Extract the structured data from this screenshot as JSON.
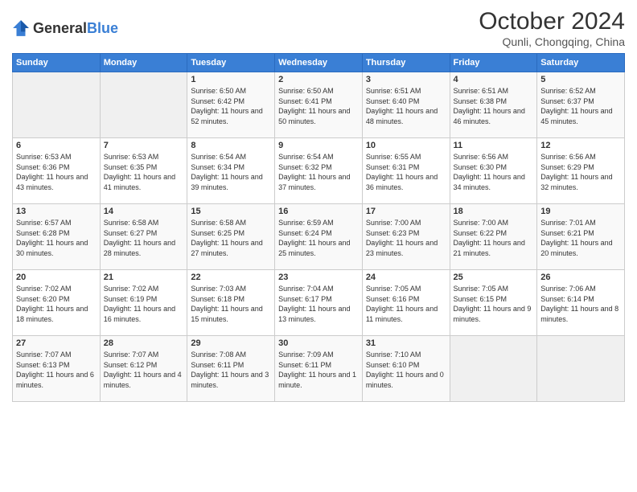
{
  "header": {
    "logo_general": "General",
    "logo_blue": "Blue",
    "title": "October 2024",
    "subtitle": "Qunli, Chongqing, China"
  },
  "weekdays": [
    "Sunday",
    "Monday",
    "Tuesday",
    "Wednesday",
    "Thursday",
    "Friday",
    "Saturday"
  ],
  "weeks": [
    [
      {
        "day": "",
        "empty": true
      },
      {
        "day": "",
        "empty": true
      },
      {
        "day": "1",
        "sunrise": "6:50 AM",
        "sunset": "6:42 PM",
        "daylight": "11 hours and 52 minutes."
      },
      {
        "day": "2",
        "sunrise": "6:50 AM",
        "sunset": "6:41 PM",
        "daylight": "11 hours and 50 minutes."
      },
      {
        "day": "3",
        "sunrise": "6:51 AM",
        "sunset": "6:40 PM",
        "daylight": "11 hours and 48 minutes."
      },
      {
        "day": "4",
        "sunrise": "6:51 AM",
        "sunset": "6:38 PM",
        "daylight": "11 hours and 46 minutes."
      },
      {
        "day": "5",
        "sunrise": "6:52 AM",
        "sunset": "6:37 PM",
        "daylight": "11 hours and 45 minutes."
      }
    ],
    [
      {
        "day": "6",
        "sunrise": "6:53 AM",
        "sunset": "6:36 PM",
        "daylight": "11 hours and 43 minutes."
      },
      {
        "day": "7",
        "sunrise": "6:53 AM",
        "sunset": "6:35 PM",
        "daylight": "11 hours and 41 minutes."
      },
      {
        "day": "8",
        "sunrise": "6:54 AM",
        "sunset": "6:34 PM",
        "daylight": "11 hours and 39 minutes."
      },
      {
        "day": "9",
        "sunrise": "6:54 AM",
        "sunset": "6:32 PM",
        "daylight": "11 hours and 37 minutes."
      },
      {
        "day": "10",
        "sunrise": "6:55 AM",
        "sunset": "6:31 PM",
        "daylight": "11 hours and 36 minutes."
      },
      {
        "day": "11",
        "sunrise": "6:56 AM",
        "sunset": "6:30 PM",
        "daylight": "11 hours and 34 minutes."
      },
      {
        "day": "12",
        "sunrise": "6:56 AM",
        "sunset": "6:29 PM",
        "daylight": "11 hours and 32 minutes."
      }
    ],
    [
      {
        "day": "13",
        "sunrise": "6:57 AM",
        "sunset": "6:28 PM",
        "daylight": "11 hours and 30 minutes."
      },
      {
        "day": "14",
        "sunrise": "6:58 AM",
        "sunset": "6:27 PM",
        "daylight": "11 hours and 28 minutes."
      },
      {
        "day": "15",
        "sunrise": "6:58 AM",
        "sunset": "6:25 PM",
        "daylight": "11 hours and 27 minutes."
      },
      {
        "day": "16",
        "sunrise": "6:59 AM",
        "sunset": "6:24 PM",
        "daylight": "11 hours and 25 minutes."
      },
      {
        "day": "17",
        "sunrise": "7:00 AM",
        "sunset": "6:23 PM",
        "daylight": "11 hours and 23 minutes."
      },
      {
        "day": "18",
        "sunrise": "7:00 AM",
        "sunset": "6:22 PM",
        "daylight": "11 hours and 21 minutes."
      },
      {
        "day": "19",
        "sunrise": "7:01 AM",
        "sunset": "6:21 PM",
        "daylight": "11 hours and 20 minutes."
      }
    ],
    [
      {
        "day": "20",
        "sunrise": "7:02 AM",
        "sunset": "6:20 PM",
        "daylight": "11 hours and 18 minutes."
      },
      {
        "day": "21",
        "sunrise": "7:02 AM",
        "sunset": "6:19 PM",
        "daylight": "11 hours and 16 minutes."
      },
      {
        "day": "22",
        "sunrise": "7:03 AM",
        "sunset": "6:18 PM",
        "daylight": "11 hours and 15 minutes."
      },
      {
        "day": "23",
        "sunrise": "7:04 AM",
        "sunset": "6:17 PM",
        "daylight": "11 hours and 13 minutes."
      },
      {
        "day": "24",
        "sunrise": "7:05 AM",
        "sunset": "6:16 PM",
        "daylight": "11 hours and 11 minutes."
      },
      {
        "day": "25",
        "sunrise": "7:05 AM",
        "sunset": "6:15 PM",
        "daylight": "11 hours and 9 minutes."
      },
      {
        "day": "26",
        "sunrise": "7:06 AM",
        "sunset": "6:14 PM",
        "daylight": "11 hours and 8 minutes."
      }
    ],
    [
      {
        "day": "27",
        "sunrise": "7:07 AM",
        "sunset": "6:13 PM",
        "daylight": "11 hours and 6 minutes."
      },
      {
        "day": "28",
        "sunrise": "7:07 AM",
        "sunset": "6:12 PM",
        "daylight": "11 hours and 4 minutes."
      },
      {
        "day": "29",
        "sunrise": "7:08 AM",
        "sunset": "6:11 PM",
        "daylight": "11 hours and 3 minutes."
      },
      {
        "day": "30",
        "sunrise": "7:09 AM",
        "sunset": "6:11 PM",
        "daylight": "11 hours and 1 minute."
      },
      {
        "day": "31",
        "sunrise": "7:10 AM",
        "sunset": "6:10 PM",
        "daylight": "11 hours and 0 minutes."
      },
      {
        "day": "",
        "empty": true
      },
      {
        "day": "",
        "empty": true
      }
    ]
  ]
}
